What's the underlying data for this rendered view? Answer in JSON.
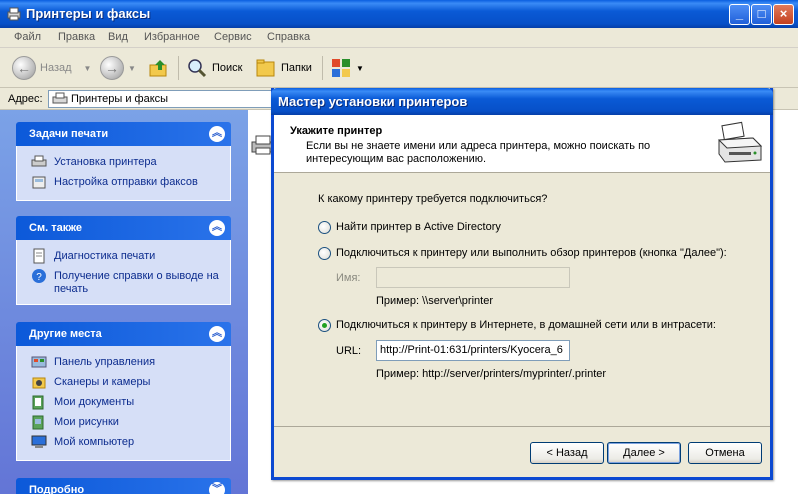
{
  "window": {
    "title": "Принтеры и факсы"
  },
  "menu": [
    "Файл",
    "Правка",
    "Вид",
    "Избранное",
    "Сервис",
    "Справка"
  ],
  "toolbar": {
    "back": "Назад",
    "search": "Поиск",
    "folders": "Папки"
  },
  "address": {
    "label": "Адрес:",
    "value": "Принтеры и факсы"
  },
  "sidebar": {
    "print_tasks": {
      "title": "Задачи печати",
      "items": [
        "Установка принтера",
        "Настройка отправки факсов"
      ]
    },
    "see_also": {
      "title": "См. также",
      "items": [
        "Диагностика печати",
        "Получение справки о выводе на печать"
      ]
    },
    "other_places": {
      "title": "Другие места",
      "items": [
        "Панель управления",
        "Сканеры и камеры",
        "Мои документы",
        "Мои рисунки",
        "Мой компьютер"
      ]
    },
    "details": {
      "title": "Подробно"
    }
  },
  "wizard": {
    "title": "Мастер установки принтеров",
    "header_title": "Укажите принтер",
    "header_desc": "Если вы не знаете имени или адреса принтера, можно поискать по интересующим вас  расположению.",
    "question": "К какому принтеру требуется подключиться?",
    "option1": "Найти принтер в Active Directory",
    "option2": "Подключиться к принтеру или выполнить обзор принтеров (кнопка \"Далее\"):",
    "name_label": "Имя:",
    "name_value": "",
    "name_example": "Пример: \\\\server\\printer",
    "option3": "Подключиться к принтеру в Интернете, в домашней сети или в интрасети:",
    "url_label": "URL:",
    "url_value": "http://Print-01:631/printers/Kyocera_6",
    "url_example": "Пример: http://server/printers/myprinter/.printer",
    "selected_option": 3,
    "buttons": {
      "back": "< Назад",
      "next": "Далее >",
      "cancel": "Отмена"
    }
  }
}
